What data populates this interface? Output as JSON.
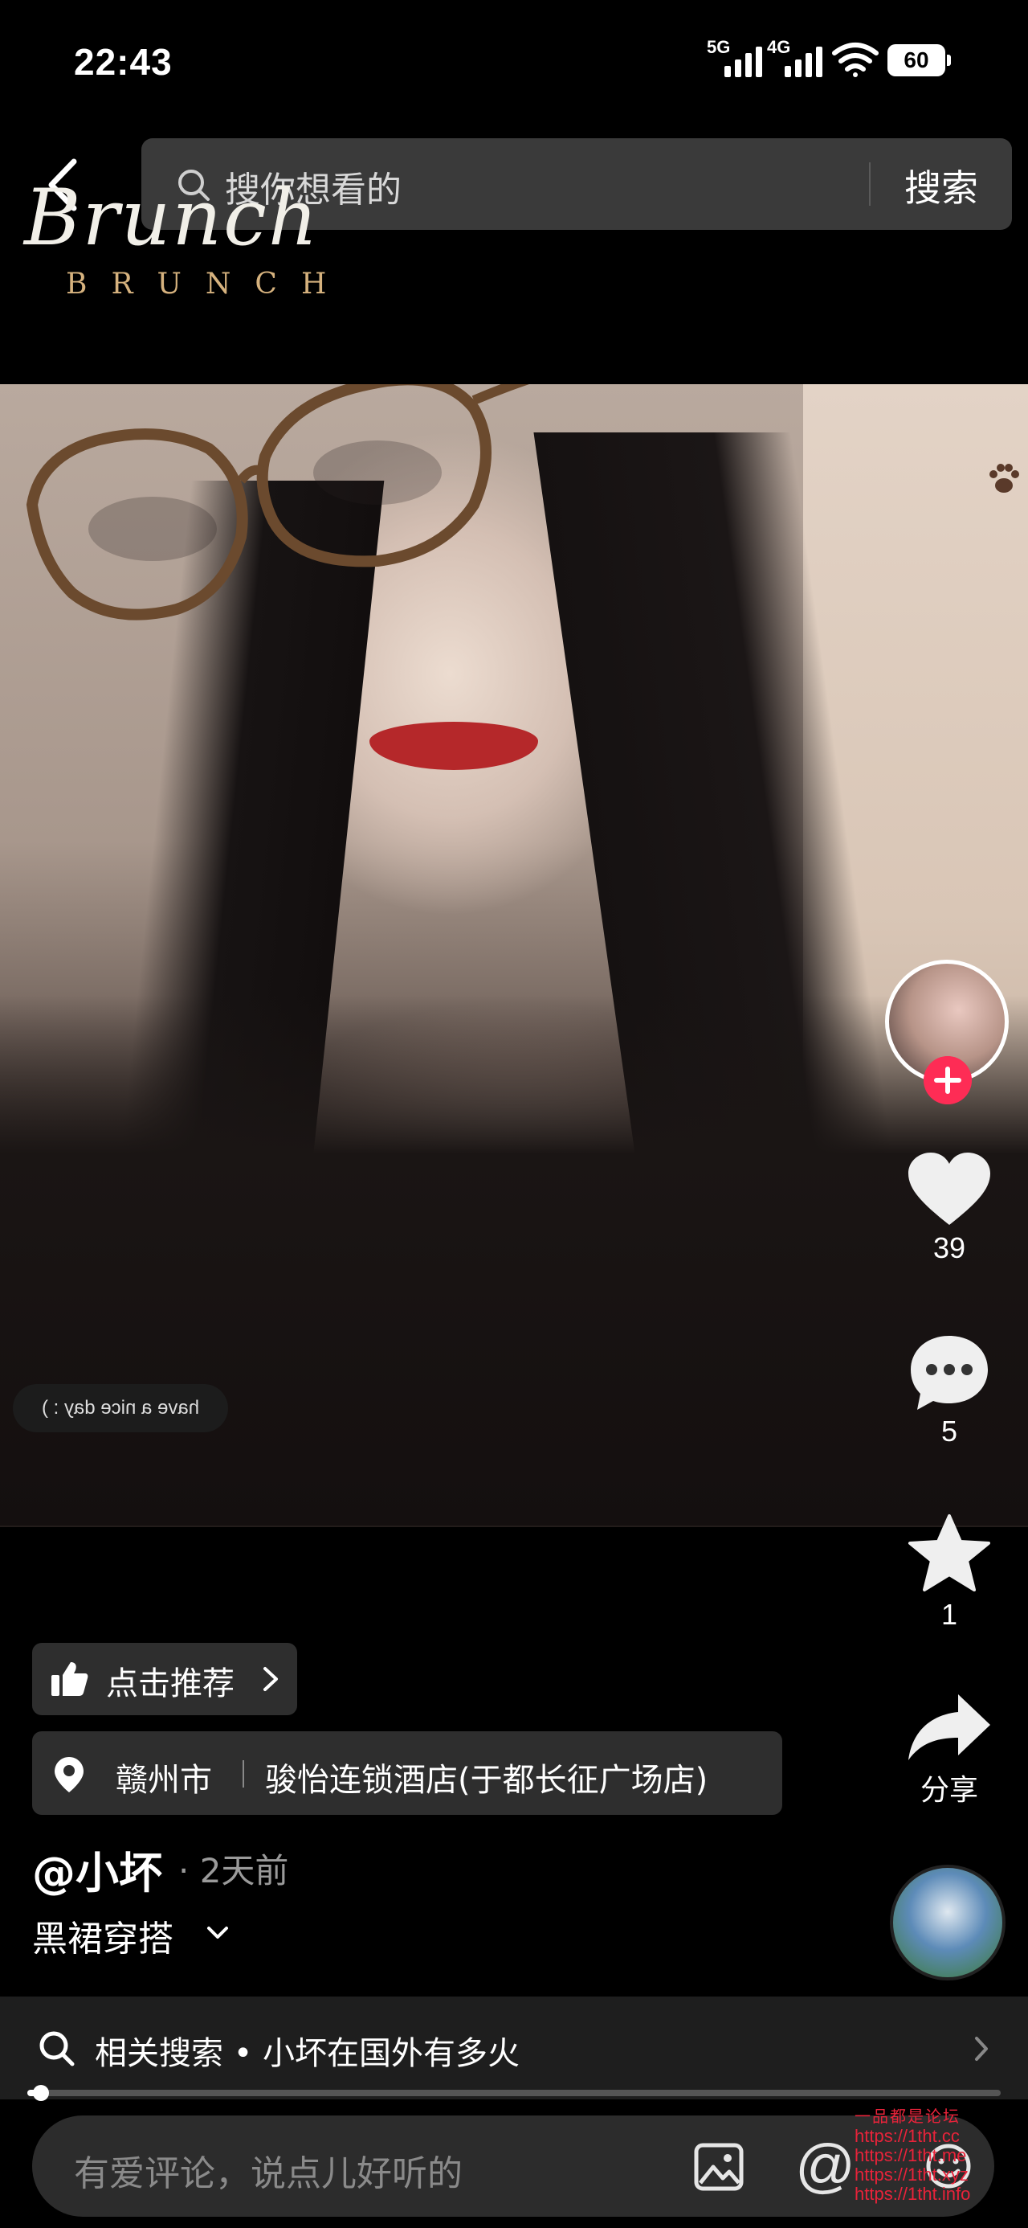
{
  "status_bar": {
    "time": "22:43",
    "network_1": "5G",
    "network_2": "4G",
    "battery": "60"
  },
  "search": {
    "placeholder": "搜你想看的",
    "submit_label": "搜索"
  },
  "brand": {
    "script": "Brunch",
    "caps": "BRUNCH"
  },
  "video": {
    "sticker_text": "have a nice day : )"
  },
  "rail": {
    "like_count": "39",
    "comment_count": "5",
    "favorite_count": "1",
    "share_label": "分享"
  },
  "info": {
    "recommend_label": "点击推荐",
    "location_city": "赣州市",
    "location_place": "骏怡连锁酒店(于都长征广场店)",
    "author": "@小坏",
    "post_time": "· 2天前",
    "caption": "黑裙穿搭"
  },
  "related": {
    "text": "相关搜索 • 小坏在国外有多火"
  },
  "progress": {
    "fraction": 0.014
  },
  "comment": {
    "placeholder": "有爱评论，说点儿好听的"
  },
  "watermark": {
    "title": "一品都是论坛",
    "lines": [
      "https://1tht.cc",
      "https://1tht.me",
      "https://1tht.xyz",
      "https://1tht.info"
    ]
  },
  "colors": {
    "accent": "#fe2c55",
    "chip_bg": "#2e2e2e",
    "watermark": "#e8233a"
  }
}
